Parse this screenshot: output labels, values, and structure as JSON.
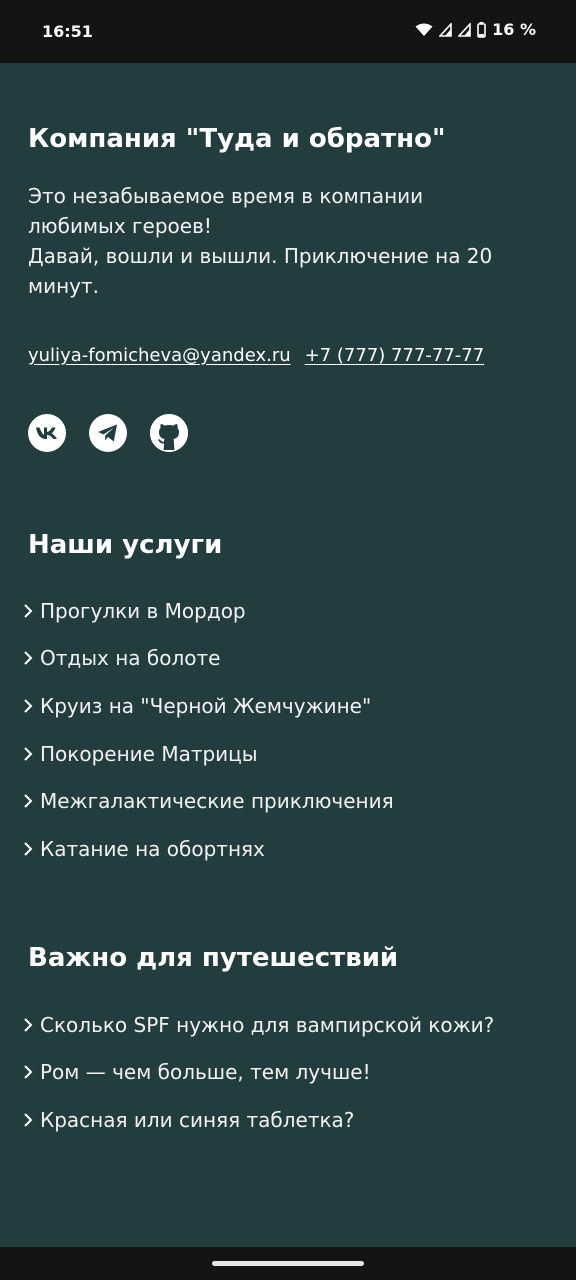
{
  "status_bar": {
    "time": "16:51",
    "battery": "16 %",
    "icons": [
      "wifi-icon",
      "signal-icon",
      "signal-icon",
      "battery-icon"
    ]
  },
  "about": {
    "title": "Компания \"Туда и обратно\"",
    "lines": [
      "Это незабываемое время в компании",
      "любимых героев!",
      "Давай, вошли и вышли. Приключение на 20",
      "минут."
    ],
    "email": "yuliya-fomicheva@yandex.ru",
    "phone": "+7 (777) 777-77-77",
    "socials": [
      "vk-icon",
      "telegram-icon",
      "github-icon"
    ]
  },
  "services": {
    "title": "Наши услуги",
    "items": [
      "Прогулки в Мордор",
      "Отдых на болоте",
      "Круиз на \"Черной Жемчужине\"",
      "Покорение Матрицы",
      "Межгалактические приключения",
      "Катание на обортнях"
    ]
  },
  "travel": {
    "title": "Важно для путешествий",
    "items": [
      "Сколько SPF нужно для вампирской кожи?",
      "Ром — чем больше, тем лучше!",
      "Красная или синяя таблетка?"
    ]
  },
  "colors": {
    "background": "#233c3d",
    "bars": "#141414",
    "text": "#ffffff"
  }
}
